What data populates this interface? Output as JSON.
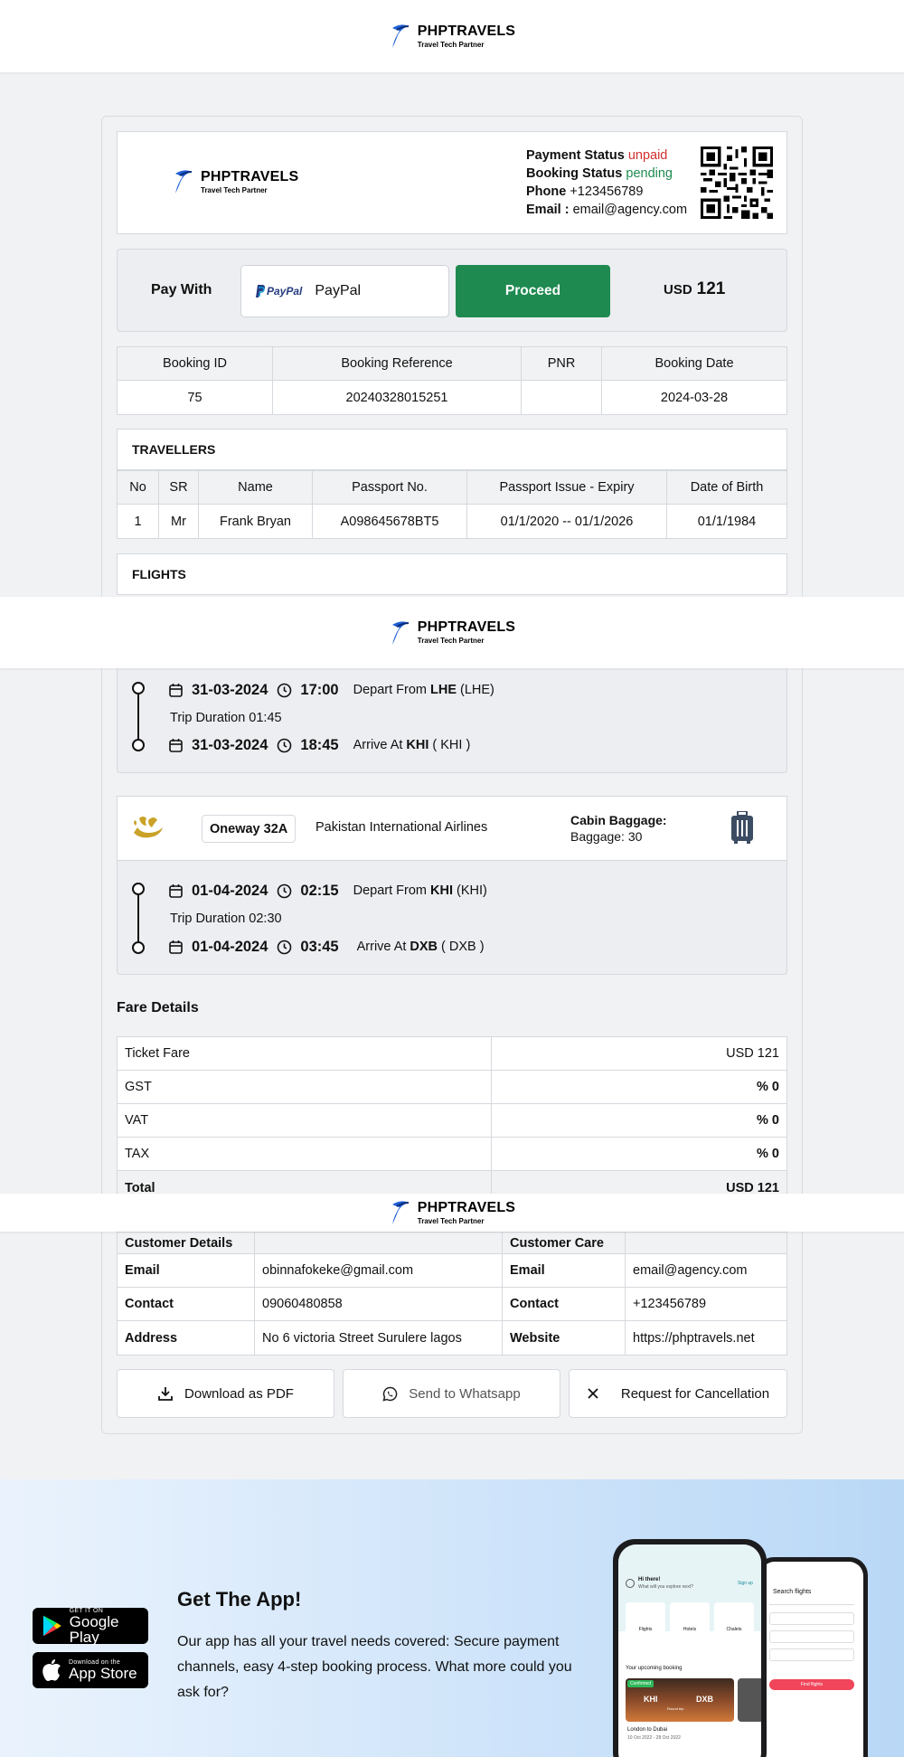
{
  "brand": {
    "name": "PHPTRAVELS",
    "tagline": "Travel Tech Partner"
  },
  "invoice_header": {
    "payment_status_label": "Payment Status",
    "payment_status": "unpaid",
    "booking_status_label": "Booking Status",
    "booking_status": "pending",
    "phone_label": "Phone",
    "phone": "+123456789",
    "email_label": "Email :",
    "email": "email@agency.com"
  },
  "payment": {
    "pay_with_label": "Pay With",
    "method_logo": "PayPal",
    "method": "PayPal",
    "proceed_label": "Proceed",
    "currency": "USD",
    "amount": "121"
  },
  "booking": {
    "headers": [
      "Booking ID",
      "Booking Reference",
      "PNR",
      "Booking Date"
    ],
    "values": [
      "75",
      "20240328015251",
      "",
      "2024-03-28"
    ]
  },
  "travellers": {
    "title": "TRAVELLERS",
    "headers": [
      "No",
      "SR",
      "Name",
      "Passport No.",
      "Passport Issue - Expiry",
      "Date of Birth"
    ],
    "rows": [
      [
        "1",
        "Mr",
        "Frank Bryan",
        "A098645678BT5",
        "01/1/2020 -- 01/1/2026",
        "01/1/1984"
      ]
    ]
  },
  "flights": {
    "title": "FLIGHTS",
    "legs": [
      {
        "depart_date": "31-03-2024",
        "depart_time": "17:00",
        "depart_label": "Depart From",
        "depart_code": "LHE",
        "depart_paren": "(LHE)",
        "duration": "Trip Duration 01:45",
        "arrive_date": "31-03-2024",
        "arrive_time": "18:45",
        "arrive_label": "Arrive At",
        "arrive_code": "KHI",
        "arrive_paren": "( KHI )"
      },
      {
        "flight_no": "Oneway 32A",
        "airline": "Pakistan International Airlines",
        "baggage_title": "Cabin Baggage:",
        "baggage": "Baggage: 30",
        "depart_date": "01-04-2024",
        "depart_time": "02:15",
        "depart_label": "Depart From",
        "depart_code": "KHI",
        "depart_paren": "(KHI)",
        "duration": "Trip Duration 02:30",
        "arrive_date": "01-04-2024",
        "arrive_time": "03:45",
        "arrive_label": "Arrive At",
        "arrive_code": "DXB",
        "arrive_paren": "( DXB )"
      }
    ]
  },
  "fare": {
    "title": "Fare Details",
    "rows": [
      {
        "label": "Ticket Fare",
        "value": "USD 121"
      },
      {
        "label": "GST",
        "value": "% 0"
      },
      {
        "label": "VAT",
        "value": "% 0"
      },
      {
        "label": "TAX",
        "value": "% 0"
      },
      {
        "label": "Total",
        "value": "USD 121"
      }
    ]
  },
  "contacts": {
    "customer_title": "Customer Details",
    "care_title": "Customer Care",
    "rows": [
      {
        "l1": "Email",
        "v1": "obinnafokeke@gmail.com",
        "l2": "Email",
        "v2": "email@agency.com"
      },
      {
        "l1": "Contact",
        "v1": "09060480858",
        "l2": "Contact",
        "v2": "+123456789"
      },
      {
        "l1": "Address",
        "v1": "No 6 victoria Street Surulere lagos",
        "l2": "Website",
        "v2": "https://phptravels.net"
      }
    ]
  },
  "actions": {
    "download": "Download as PDF",
    "whatsapp": "Send to Whatsapp",
    "cancel": "Request for Cancellation"
  },
  "app": {
    "title": "Get The App!",
    "text": "Our app has all your travel needs covered: Secure payment channels, easy 4-step booking process. What more could you ask for?",
    "google_small": "GET IT ON",
    "google_big": "Google Play",
    "apple_small": "Download on the",
    "apple_big": "App Store",
    "phone": {
      "greeting": "Hi there!",
      "sub": "What will you explore next?",
      "signup": "Sign up",
      "tiles": [
        "Flights",
        "Hotels",
        "Chalets"
      ],
      "upcoming": "Your upcoming booking",
      "badge": "Confirmed",
      "from": "KHI",
      "to": "DXB",
      "trip": "Round trip",
      "route": "London to Dubai",
      "dates": "10 Oct 2022 - 28 Oct 2022",
      "search_title": "Search flights",
      "search_btn": "Find flights"
    }
  },
  "colors": {
    "unpaid": "#d32f2f",
    "pending": "#1e8a50",
    "proceed": "#1e8a50"
  }
}
